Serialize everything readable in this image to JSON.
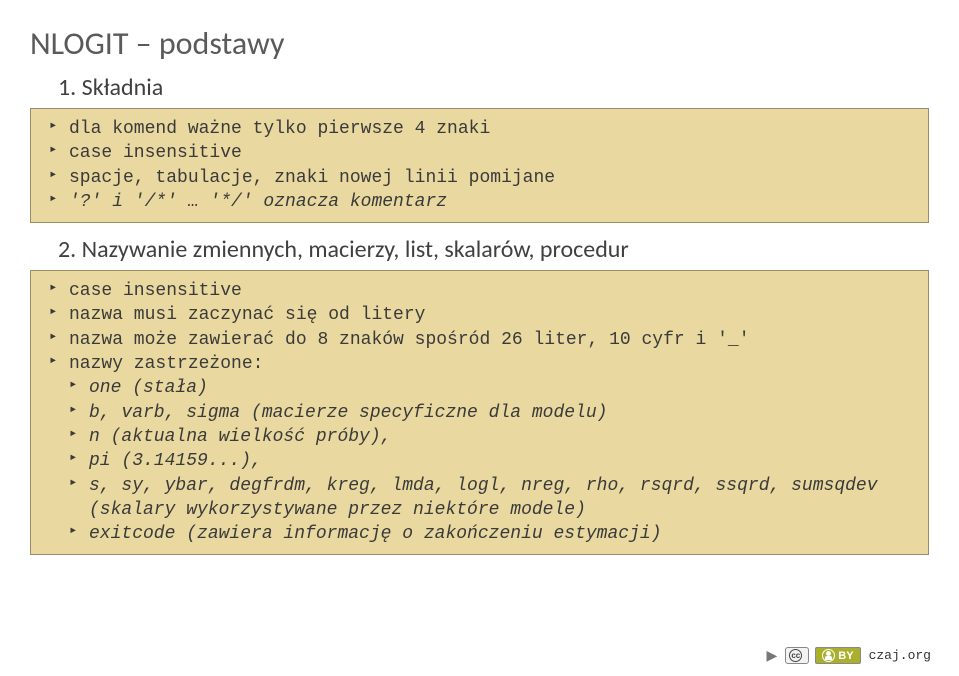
{
  "title": "NLOGIT – podstawy",
  "sections": [
    {
      "num": "1.",
      "label": "Składnia",
      "items": [
        {
          "text": "dla komend ważne tylko pierwsze 4 znaki"
        },
        {
          "text": "case insensitive"
        },
        {
          "text": "spacje, tabulacje, znaki nowej linii pomijane"
        },
        {
          "text": "'?' i '/*' … '*/' oznacza komentarz",
          "italic": true
        }
      ]
    },
    {
      "num": "2.",
      "label": "Nazywanie zmiennych, macierzy, list, skalarów, procedur",
      "items": [
        {
          "text": "case insensitive"
        },
        {
          "text": "nazwa musi zaczynać się od litery"
        },
        {
          "text": "nazwa może zawierać do 8 znaków spośród 26 liter, 10 cyfr i '_'"
        },
        {
          "text": "nazwy zastrzeżone:"
        },
        {
          "text": "one (stała)",
          "sub": true,
          "italic": true
        },
        {
          "text": "b, varb, sigma (macierze specyficzne dla modelu)",
          "sub": true,
          "italic": true
        },
        {
          "text": "n (aktualna wielkość próby),",
          "sub": true,
          "italic": true
        },
        {
          "text": "pi (3.14159...),",
          "sub": true,
          "italic": true
        },
        {
          "text": "s, sy, ybar, degfrdm, kreg, lmda, logl, nreg, rho, rsqrd, ssqrd, sumsqdev (skalary wykorzystywane przez niektóre modele)",
          "sub": true,
          "italic": true
        },
        {
          "text": "exitcode (zawiera informację o zakończeniu estymacji)",
          "sub": true,
          "italic": true
        }
      ]
    }
  ],
  "footer": {
    "cc": "cc",
    "by": "BY",
    "org": "czaj.org"
  }
}
